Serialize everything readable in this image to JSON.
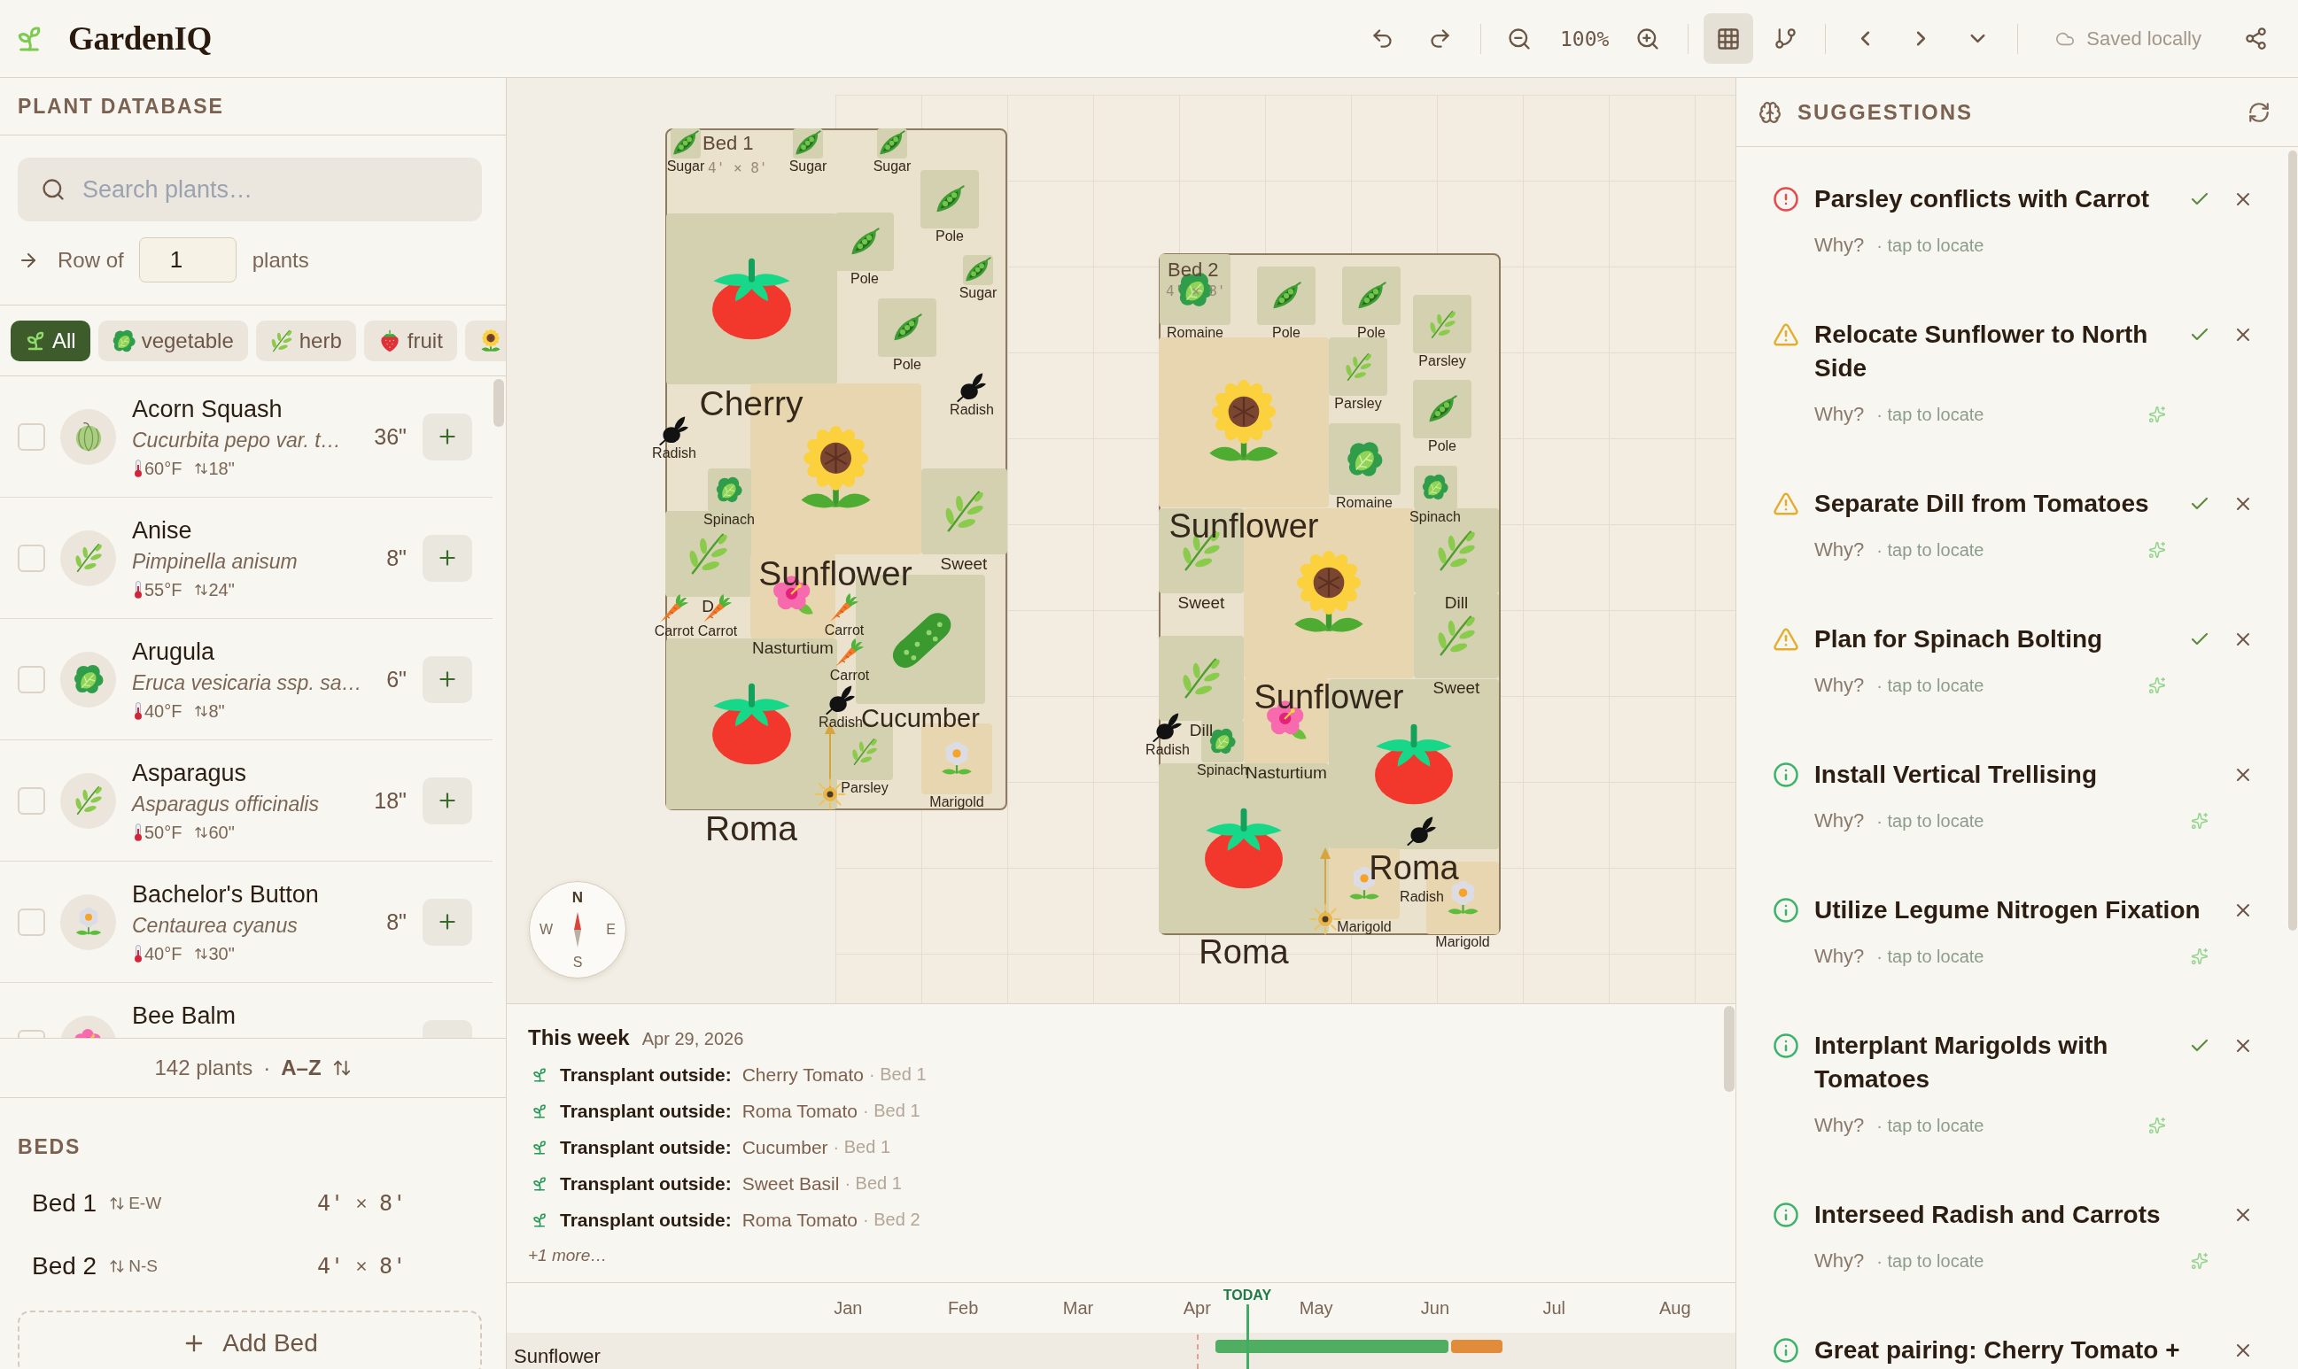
{
  "app": {
    "name": "GardenIQ"
  },
  "toolbar": {
    "zoom": "100%",
    "grid_on": true,
    "save_status": "Saved locally"
  },
  "plant_database": {
    "title": "PLANT DATABASE",
    "search": {
      "placeholder": "Search plants…"
    },
    "row_of": {
      "prefix": "Row of",
      "value": "1",
      "suffix": "plants"
    },
    "filters": [
      {
        "label": "All",
        "selected": true
      },
      {
        "label": "vegetable",
        "selected": false
      },
      {
        "label": "herb",
        "selected": false
      },
      {
        "label": "fruit",
        "selected": false
      },
      {
        "selected": false
      }
    ],
    "plants": [
      {
        "name": "Acorn Squash",
        "latin": "Cucurbita pepo var. t…",
        "kind": "squash",
        "temp": "60°F",
        "height": "18\"",
        "spacing": "36\"",
        "checked": false
      },
      {
        "name": "Anise",
        "latin": "Pimpinella anisum",
        "kind": "herb",
        "temp": "55°F",
        "height": "24\"",
        "spacing": "8\"",
        "checked": false
      },
      {
        "name": "Arugula",
        "latin": "Eruca vesicaria ssp. sa…",
        "kind": "lettuce",
        "temp": "40°F",
        "height": "8\"",
        "spacing": "6\"",
        "checked": false
      },
      {
        "name": "Asparagus",
        "latin": "Asparagus officinalis",
        "kind": "herb",
        "temp": "50°F",
        "height": "60\"",
        "spacing": "18\"",
        "checked": false
      },
      {
        "name": "Bachelor's Button",
        "latin": "Centaurea cyanus",
        "kind": "daisy",
        "temp": "40°F",
        "height": "30\"",
        "spacing": "8\"",
        "checked": false
      },
      {
        "name": "Bee Balm",
        "kind": "hibiscus",
        "checked": false
      }
    ],
    "footer": {
      "count": "142 plants",
      "separator": "·",
      "sort": "A–Z"
    }
  },
  "beds_panel": {
    "title": "BEDS",
    "beds": [
      {
        "name": "Bed 1",
        "orientation": "E-W",
        "width": "4'",
        "length": "8'"
      },
      {
        "name": "Bed 2",
        "orientation": "N-S",
        "width": "4'",
        "length": "8'"
      }
    ],
    "add_button": "Add Bed"
  },
  "garden": {
    "beds": [
      {
        "name": "Bed 1",
        "dims": "4' × 8'",
        "plants": [
          {
            "label": "Sugar",
            "kind": "pea"
          },
          {
            "label": "Sugar",
            "kind": "pea"
          },
          {
            "label": "Sugar",
            "kind": "pea"
          },
          {
            "label": "Pole",
            "kind": "pea"
          },
          {
            "label": "Cherry",
            "kind": "tomato"
          },
          {
            "label": "Pole",
            "kind": "pea"
          },
          {
            "label": "Sugar",
            "kind": "pea"
          },
          {
            "label": "Pole",
            "kind": "pea"
          },
          {
            "label": "Radish",
            "kind": "radish"
          },
          {
            "label": "Sunflower",
            "kind": "sunflower"
          },
          {
            "label": "Radish",
            "kind": "radish"
          },
          {
            "label": "Spinach",
            "kind": "lettuce"
          },
          {
            "label": "D",
            "kind": "herb"
          },
          {
            "label": "Sweet",
            "kind": "herb"
          },
          {
            "label": "Carrot",
            "kind": "carrot"
          },
          {
            "label": "Carrot",
            "kind": "carrot"
          },
          {
            "label": "Nasturtium",
            "kind": "hibiscus"
          },
          {
            "label": "Carrot",
            "kind": "carrot"
          },
          {
            "label": "Cucumber",
            "kind": "cucumber"
          },
          {
            "label": "Carrot",
            "kind": "carrot"
          },
          {
            "label": "Radish",
            "kind": "radish"
          },
          {
            "label": "Roma",
            "kind": "tomato"
          },
          {
            "label": "Parsley",
            "kind": "herb"
          },
          {
            "label": "Marigold",
            "kind": "daisy"
          }
        ]
      },
      {
        "name": "Bed 2",
        "dims": "4' × 8'",
        "plants": [
          {
            "label": "Romaine",
            "kind": "lettuce"
          },
          {
            "label": "Pole",
            "kind": "pea"
          },
          {
            "label": "Pole",
            "kind": "pea"
          },
          {
            "label": "Parsley",
            "kind": "herb"
          },
          {
            "label": "Sunflower",
            "kind": "sunflower"
          },
          {
            "label": "Parsley",
            "kind": "herb"
          },
          {
            "label": "Pole",
            "kind": "pea"
          },
          {
            "label": "Romaine",
            "kind": "lettuce"
          },
          {
            "label": "Spinach",
            "kind": "lettuce"
          },
          {
            "label": "Sweet",
            "kind": "herb"
          },
          {
            "label": "Sunflower",
            "kind": "sunflower"
          },
          {
            "label": "Dill",
            "kind": "herb"
          },
          {
            "label": "Sweet",
            "kind": "herb"
          },
          {
            "label": "Dill",
            "kind": "herb"
          },
          {
            "label": "Radish",
            "kind": "radish"
          },
          {
            "label": "Nasturtium",
            "kind": "hibiscus"
          },
          {
            "label": "Spinach",
            "kind": "lettuce"
          },
          {
            "label": "Roma",
            "kind": "tomato"
          },
          {
            "label": "Roma",
            "kind": "tomato"
          },
          {
            "label": "Marigold",
            "kind": "daisy"
          },
          {
            "label": "Marigold",
            "kind": "daisy"
          },
          {
            "label": "Radish",
            "kind": "radish"
          }
        ]
      }
    ],
    "compass": {
      "north": "N",
      "east": "E",
      "south": "S",
      "west": "W"
    }
  },
  "this_week": {
    "title": "This week",
    "date": "Apr 29, 2026",
    "tasks": [
      {
        "action": "Transplant outside:",
        "plant": "Cherry Tomato",
        "bed": "· Bed 1"
      },
      {
        "action": "Transplant outside:",
        "plant": "Roma Tomato",
        "bed": "· Bed 1"
      },
      {
        "action": "Transplant outside:",
        "plant": "Cucumber",
        "bed": "· Bed 1"
      },
      {
        "action": "Transplant outside:",
        "plant": "Sweet Basil",
        "bed": "· Bed 1"
      },
      {
        "action": "Transplant outside:",
        "plant": "Roma Tomato",
        "bed": "· Bed 2"
      }
    ],
    "more": "+1 more…"
  },
  "timeline": {
    "months": [
      "Jan",
      "Feb",
      "Mar",
      "Apr",
      "May",
      "Jun",
      "Jul",
      "Aug"
    ],
    "today_label": "TODAY",
    "rows": [
      {
        "name": "Sunflower"
      }
    ]
  },
  "suggestions": {
    "title": "SUGGESTIONS",
    "items": [
      {
        "kind": "error",
        "title": "Parsley conflicts with Carrot",
        "can_accept": true,
        "ai_generated": false,
        "why": "Why?",
        "locate": "· tap to locate"
      },
      {
        "kind": "warning",
        "title": "Relocate Sunflower to North Side",
        "can_accept": true,
        "ai_generated": true,
        "why": "Why?",
        "locate": "· tap to locate"
      },
      {
        "kind": "warning",
        "title": "Separate Dill from Tomatoes",
        "can_accept": true,
        "ai_generated": true,
        "why": "Why?",
        "locate": "· tap to locate"
      },
      {
        "kind": "warning",
        "title": "Plan for Spinach Bolting",
        "can_accept": true,
        "ai_generated": true,
        "why": "Why?",
        "locate": "· tap to locate"
      },
      {
        "kind": "info",
        "title": "Install Vertical Trellising",
        "can_accept": false,
        "ai_generated": true,
        "why": "Why?",
        "locate": "· tap to locate"
      },
      {
        "kind": "info",
        "title": "Utilize Legume Nitrogen Fixation",
        "can_accept": false,
        "ai_generated": true,
        "why": "Why?",
        "locate": "· tap to locate"
      },
      {
        "kind": "info",
        "title": "Interplant Marigolds with Tomatoes",
        "can_accept": true,
        "ai_generated": true,
        "why": "Why?",
        "locate": "· tap to locate"
      },
      {
        "kind": "info",
        "title": "Interseed Radish and Carrots",
        "can_accept": false,
        "ai_generated": true,
        "why": "Why?",
        "locate": "· tap to locate"
      },
      {
        "kind": "info",
        "title": "Great pairing: Cherry Tomato +",
        "can_accept": false,
        "ai_generated": false
      }
    ]
  }
}
